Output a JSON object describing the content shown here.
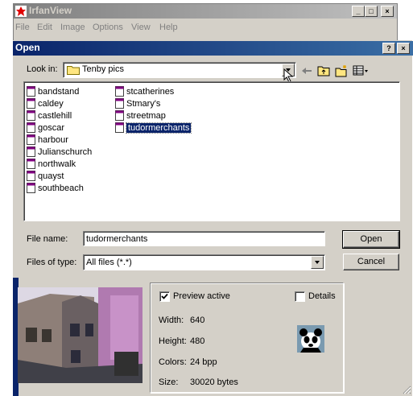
{
  "app": {
    "title": "IrfanView",
    "menus": [
      "File",
      "Edit",
      "Image",
      "Options",
      "View",
      "Help"
    ],
    "window_buttons": [
      "_",
      "□",
      "×"
    ]
  },
  "dialog": {
    "title": "Open",
    "title_buttons": [
      "?",
      "×"
    ],
    "look_in_label": "Look in:",
    "look_in_value": "Tenby pics",
    "files_col1": [
      "bandstand",
      "caldey",
      "castlehill",
      "goscar",
      "harbour",
      "Julianschurch",
      "northwalk",
      "quayst",
      "southbeach"
    ],
    "files_col2": [
      "stcatherines",
      "Stmary's",
      "streetmap",
      "tudormerchants"
    ],
    "selected_file": "tudormerchants",
    "filename_label": "File name:",
    "filename_value": "tudormerchants",
    "filetype_label": "Files of type:",
    "filetype_value": "All files (*.*)",
    "open_button": "Open",
    "cancel_button": "Cancel"
  },
  "preview": {
    "preview_active_label": "Preview active",
    "preview_active_checked": true,
    "details_label": "Details",
    "details_checked": false,
    "width_label": "Width:",
    "width_value": "640",
    "height_label": "Height:",
    "height_value": "480",
    "colors_label": "Colors:",
    "colors_value": "24 bpp",
    "size_label": "Size:",
    "size_value": "30020 bytes"
  },
  "colors": {
    "active_title": "#0a246a",
    "inactive_title": "#808080",
    "face": "#d4d0c8",
    "selection": "#0a246a"
  }
}
